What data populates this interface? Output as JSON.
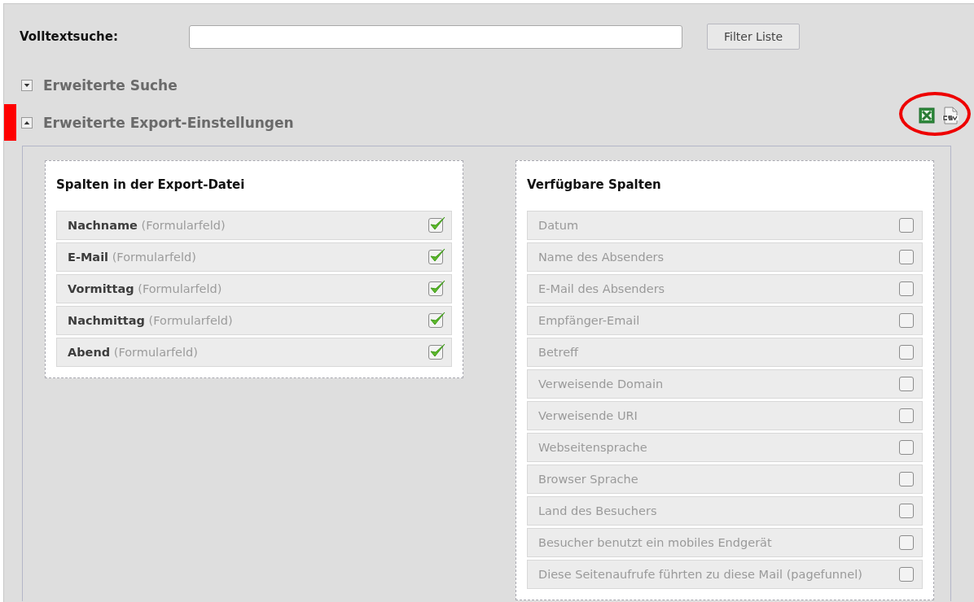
{
  "search": {
    "label": "Volltextsuche:",
    "button": "Filter Liste"
  },
  "sections": [
    {
      "label": "Erweiterte Suche",
      "expanded": false
    },
    {
      "label": "Erweiterte Export-Einstellungen",
      "expanded": true
    }
  ],
  "panels": [
    {
      "title": "Spalten in der Export-Datei",
      "items": [
        {
          "name": "Nachname",
          "suffix": "(Formularfeld)",
          "checked": true
        },
        {
          "name": "E-Mail",
          "suffix": "(Formularfeld)",
          "checked": true
        },
        {
          "name": "Vormittag",
          "suffix": "(Formularfeld)",
          "checked": true
        },
        {
          "name": "Nachmittag",
          "suffix": "(Formularfeld)",
          "checked": true
        },
        {
          "name": "Abend",
          "suffix": "(Formularfeld)",
          "checked": true
        }
      ]
    },
    {
      "title": "Verfügbare Spalten",
      "items": [
        {
          "name": "Datum",
          "checked": false
        },
        {
          "name": "Name des Absenders",
          "checked": false
        },
        {
          "name": "E-Mail des Absenders",
          "checked": false
        },
        {
          "name": "Empfänger-Email",
          "checked": false
        },
        {
          "name": "Betreff",
          "checked": false
        },
        {
          "name": "Verweisende Domain",
          "checked": false
        },
        {
          "name": "Verweisende URI",
          "checked": false
        },
        {
          "name": "Webseitensprache",
          "checked": false
        },
        {
          "name": "Browser Sprache",
          "checked": false
        },
        {
          "name": "Land des Besuchers",
          "checked": false
        },
        {
          "name": "Besucher benutzt ein mobiles Endgerät",
          "checked": false
        },
        {
          "name": "Diese Seitenaufrufe führten zu diese Mail (pagefunnel)",
          "checked": false
        }
      ]
    }
  ]
}
